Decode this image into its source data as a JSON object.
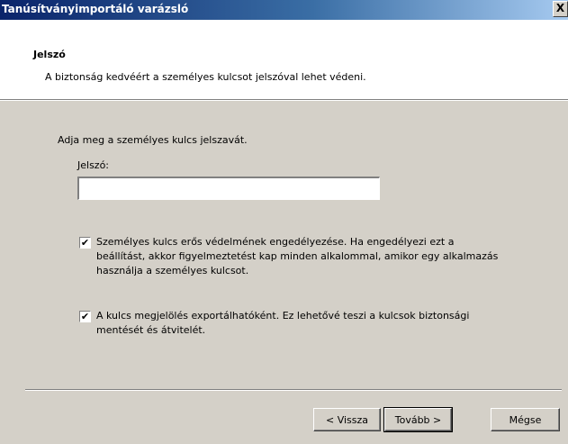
{
  "window": {
    "title": "Tanúsítványimportáló varázsló",
    "close_glyph": "X"
  },
  "header": {
    "title": "Jelszó",
    "subtitle": "A biztonság kedvéért a személyes kulcsot jelszóval lehet védeni."
  },
  "body": {
    "instruction": "Adja meg a személyes kulcs jelszavát.",
    "password_label": "Jelszó:",
    "password_value": "",
    "checkbox1": {
      "checked": true,
      "lines": [
        "Személyes kulcs erős védelmének engedélyezése. Ha engedélyezi ezt a",
        "beállítást, akkor figyelmeztetést kap minden alkalommal, amikor egy alkalmazás",
        "használja a személyes kulcsot."
      ]
    },
    "checkbox2": {
      "checked": true,
      "lines": [
        "A kulcs megjelölés exportálhatóként. Ez lehetővé teszi a kulcsok biztonsági",
        "mentését és átvitelét."
      ]
    }
  },
  "buttons": {
    "back": "< Vissza",
    "next": "Tovább >",
    "cancel": "Mégse"
  },
  "icons": {
    "check_glyph": "✔"
  }
}
